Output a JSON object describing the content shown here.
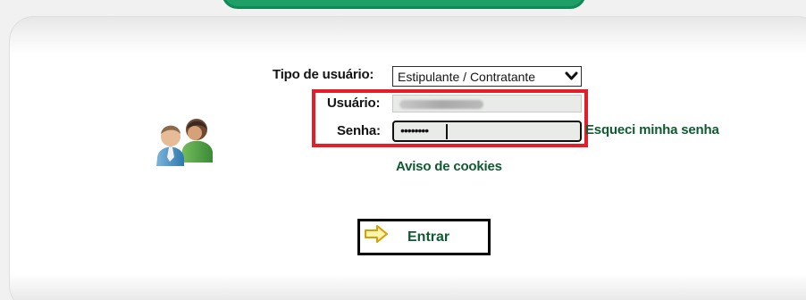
{
  "login": {
    "tipo_label": "Tipo de usuário:",
    "tipo_value": "Estipulante / Contratante",
    "usuario_label": "Usuário:",
    "senha_label": "Senha:",
    "password_mask": "••••••••",
    "forgot_link": "Esqueci minha senha",
    "cookies_link": "Aviso de cookies",
    "enter_button": "Entrar"
  },
  "icons": {
    "users": "users-icon",
    "select_chevron": "chevron-down-icon",
    "enter_arrow": "arrow-right-icon"
  },
  "colors": {
    "accent_green": "#1f9f68",
    "link_green": "#0f5b31",
    "highlight_red": "#e41e28"
  }
}
